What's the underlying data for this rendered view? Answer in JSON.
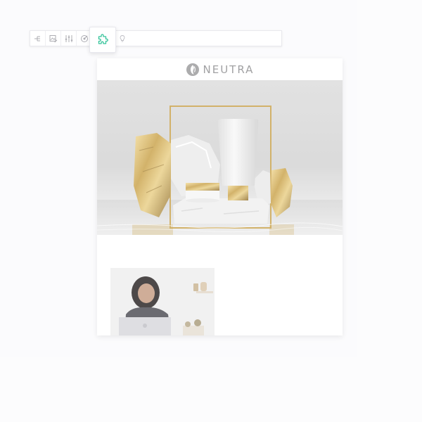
{
  "toolbar": {
    "buttons": [
      {
        "icon": "tree-structure-icon"
      },
      {
        "icon": "image-edit-icon"
      },
      {
        "icon": "sliders-icon"
      },
      {
        "icon": "target-icon"
      }
    ],
    "active_tool": {
      "icon": "puzzle-piece-icon",
      "color": "#35c49a"
    },
    "hidden_tool": {
      "icon": "lightbulb-icon"
    }
  },
  "email": {
    "brand": {
      "name": "NEUTRA",
      "logo_icon": "leaf-logo-icon",
      "color": "#8d8d8f"
    },
    "hero": {
      "description_icon": "cosmetic-product-scene-image",
      "accent_color": "#c9a24a"
    },
    "photo": {
      "description_icon": "woman-with-laptop-image"
    }
  }
}
